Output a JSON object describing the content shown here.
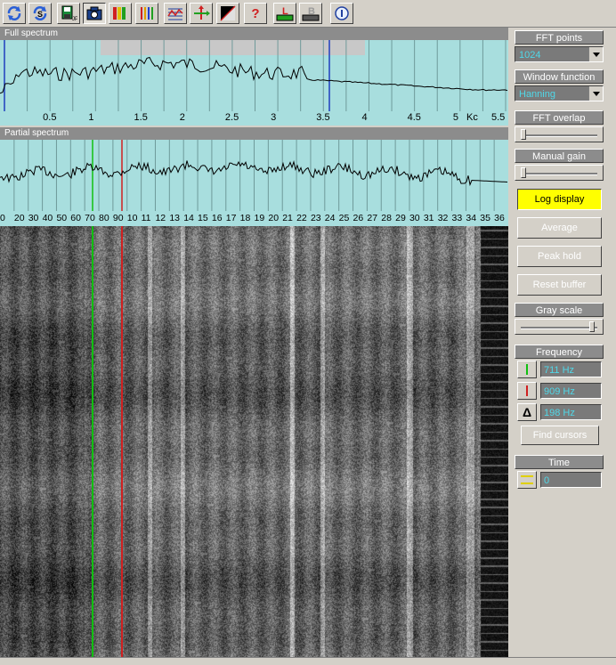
{
  "toolbar": {
    "icons": [
      "refresh-icon",
      "refresh-s-icon",
      "save-icon",
      "camera-icon",
      "color-bars-icon",
      "bars-icon",
      "grid-icon",
      "axes-icon",
      "contrast-icon",
      "help-icon",
      "marker-l-icon",
      "marker-b-icon",
      "about-icon"
    ],
    "help_glyph": "?",
    "marker_l_glyph": "L",
    "marker_b_glyph": "B"
  },
  "full_spectrum": {
    "title": "Full spectrum",
    "ticks": [
      "0.5",
      "1",
      "1.5",
      "2",
      "2.5",
      "3",
      "3.5",
      "4",
      "4.5",
      "5"
    ],
    "unit": "Kc",
    "end_tick": "5.5"
  },
  "partial_spectrum": {
    "title": "Partial spectrum",
    "ticks": [
      "0",
      "20",
      "30",
      "40",
      "50",
      "60",
      "70",
      "80",
      "90",
      "10",
      "11",
      "12",
      "13",
      "14",
      "15",
      "16",
      "17",
      "18",
      "19",
      "20",
      "21",
      "22",
      "23",
      "24",
      "25",
      "26",
      "27",
      "28",
      "29",
      "30",
      "31",
      "32",
      "33",
      "34",
      "35",
      "36"
    ]
  },
  "controls": {
    "fft_points": {
      "title": "FFT points",
      "value": "1024"
    },
    "window_function": {
      "title": "Window function",
      "value": "Hanning"
    },
    "fft_overlap": {
      "title": "FFT overlap",
      "level": 0.05
    },
    "manual_gain": {
      "title": "Manual gain",
      "level": 0.05
    },
    "log_display": "Log display",
    "average": "Average",
    "peak_hold": "Peak hold",
    "reset_buffer": "Reset buffer",
    "gray_scale": {
      "title": "Gray scale",
      "level": 0.97
    },
    "frequency": {
      "title": "Frequency",
      "cursor1": "711 Hz",
      "cursor2": "909 Hz",
      "delta": "198 Hz",
      "delta_glyph": "Δ"
    },
    "find_cursors": "Find cursors",
    "time": {
      "title": "Time",
      "value": "0"
    }
  },
  "colors": {
    "green_cursor": "#10c010",
    "red_cursor": "#d02020",
    "blue_marker": "#1f3fbf",
    "plot_bg": "#a8dede",
    "value_text": "#50d8e8"
  }
}
